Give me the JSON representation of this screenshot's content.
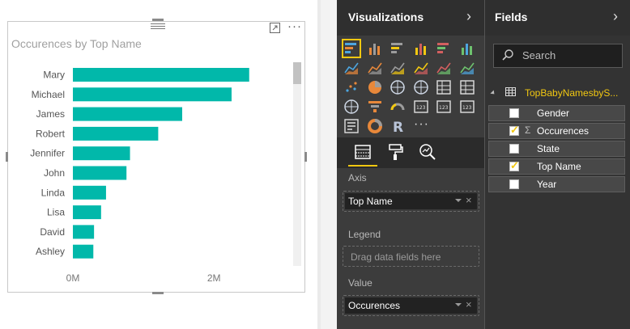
{
  "visual": {
    "more_glyph": "···"
  },
  "chart_data": {
    "type": "bar",
    "orientation": "horizontal",
    "title": "Occurences by Top Name",
    "categories": [
      "Mary",
      "Michael",
      "James",
      "Robert",
      "Jennifer",
      "John",
      "Linda",
      "Lisa",
      "David",
      "Ashley"
    ],
    "values": [
      2500000,
      2250000,
      1550000,
      1210000,
      810000,
      760000,
      470000,
      400000,
      300000,
      290000
    ],
    "x_ticks": [
      {
        "value": 0,
        "label": "0M"
      },
      {
        "value": 2000000,
        "label": "2M"
      }
    ],
    "xlim": [
      0,
      3100000
    ],
    "bar_color": "#01b8aa",
    "grid": false,
    "legend": "none"
  },
  "visualizations": {
    "title": "Visualizations",
    "chevron": "›",
    "icons": [
      "stacked-bar-chart-icon",
      "stacked-column-chart-icon",
      "clustered-bar-chart-icon",
      "clustered-column-chart-icon",
      "100-percent-stacked-bar-chart-icon",
      "100-percent-stacked-column-chart-icon",
      "line-chart-icon",
      "area-chart-icon",
      "stacked-area-chart-icon",
      "line-and-stacked-column-chart-icon",
      "line-and-clustered-column-chart-icon",
      "ribbon-chart-icon",
      "scatter-chart-icon",
      "pie-chart-icon",
      "treemap-icon",
      "map-icon",
      "table-icon",
      "matrix-icon",
      "filled-map-icon",
      "funnel-icon",
      "gauge-icon",
      "multi-row-card-icon",
      "card-icon",
      "kpi-icon",
      "slicer-icon",
      "donut-chart-icon",
      "r-script-visual-icon"
    ],
    "more_glyph": "···",
    "tabs": [
      "fields-tab-icon",
      "format-paintroller-icon",
      "analytics-magnifier-icon"
    ],
    "wells": {
      "axis": {
        "label": "Axis",
        "item": "Top Name"
      },
      "legend": {
        "label": "Legend",
        "placeholder": "Drag data fields here"
      },
      "value": {
        "label": "Value",
        "item": "Occurences"
      }
    },
    "remove_glyph": "×",
    "accent": "#f2c811"
  },
  "fields": {
    "title": "Fields",
    "chevron": "›",
    "search_placeholder": "Search",
    "table_name": "TopBabyNamesbyS...",
    "items": [
      {
        "name": "Gender",
        "checked": false,
        "sigma": false
      },
      {
        "name": "Occurences",
        "checked": true,
        "sigma": true
      },
      {
        "name": "State",
        "checked": false,
        "sigma": false
      },
      {
        "name": "Top Name",
        "checked": true,
        "sigma": false
      },
      {
        "name": "Year",
        "checked": false,
        "sigma": false
      }
    ],
    "sigma_glyph": "Σ",
    "tick_glyph": "✓"
  }
}
